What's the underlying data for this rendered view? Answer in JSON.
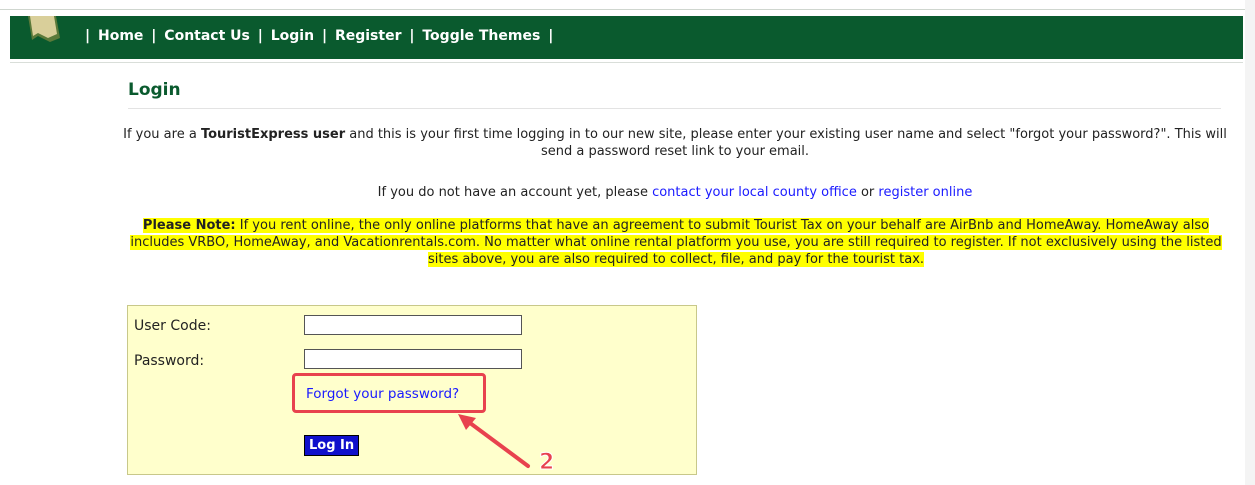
{
  "nav": {
    "links": [
      "Home",
      "Contact Us",
      "Login",
      "Register",
      "Toggle Themes"
    ],
    "separator": "|"
  },
  "page": {
    "title": "Login"
  },
  "intro": {
    "p1_before": "If you are a ",
    "p1_bold": "TouristExpress user",
    "p1_after": " and this is your first time logging in to our new site, please enter your existing user name and select \"forgot your password?\". This will send a password reset link to your email.",
    "p2_before": "If you do not have an account yet, please ",
    "p2_link1": "contact your local county office",
    "p2_mid": " or ",
    "p2_link2": "register online"
  },
  "note": {
    "label": "Please Note:",
    "text": " If you rent online, the only online platforms that have an agreement to submit Tourist Tax on your behalf are AirBnb and HomeAway. HomeAway also includes VRBO, HomeAway, and Vacationrentals.com. No matter what online rental platform you use, you are still required to register. If not exclusively using the listed sites above, you are also required to collect, file, and pay for the tourist tax."
  },
  "form": {
    "user_code_label": "User Code:",
    "user_code_value": "",
    "password_label": "Password:",
    "password_value": "",
    "forgot_link": "Forgot your password?",
    "login_button": "Log In"
  },
  "annotation": {
    "number": "2",
    "color": "#e8424e"
  },
  "colors": {
    "nav_bg": "#0a5a2e",
    "title": "#0a5a2e",
    "link": "#1a1aff",
    "highlight": "#ffff00",
    "login_box_bg": "#ffffcc",
    "button_bg": "#1010cc"
  }
}
